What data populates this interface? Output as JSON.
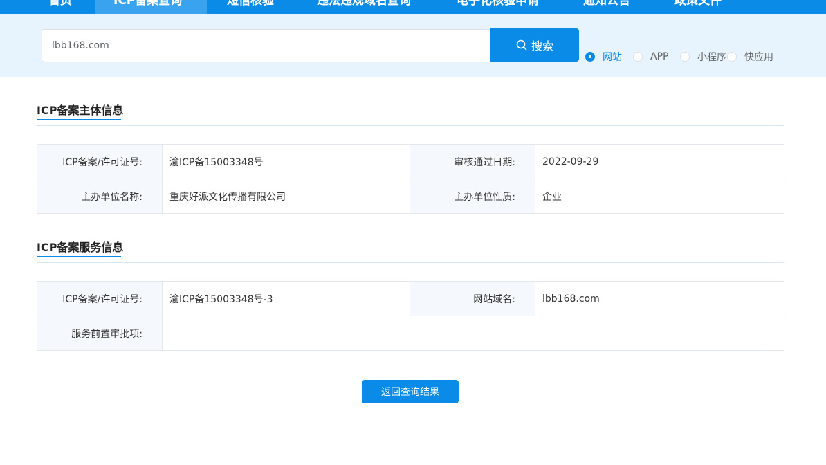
{
  "nav": {
    "items": [
      {
        "label": "首页"
      },
      {
        "label": "ICP备案查询"
      },
      {
        "label": "短信核验"
      },
      {
        "label": "违法违规域名查询"
      },
      {
        "label": "电子化核验申请"
      },
      {
        "label": "通知公告"
      },
      {
        "label": "政策文件"
      }
    ],
    "active_index": 1
  },
  "search": {
    "value": "lbb168.com",
    "button_label": "搜索",
    "options": [
      "网站",
      "APP",
      "小程序",
      "快应用"
    ],
    "selected": "网站"
  },
  "subject_section": {
    "title": "ICP备案主体信息",
    "rows": [
      [
        {
          "label": "ICP备案/许可证号:",
          "value": "渝ICP备15003348号"
        },
        {
          "label": "审核通过日期:",
          "value": "2022-09-29"
        }
      ],
      [
        {
          "label": "主办单位名称:",
          "value": "重庆好派文化传播有限公司"
        },
        {
          "label": "主办单位性质:",
          "value": "企业"
        }
      ]
    ]
  },
  "service_section": {
    "title": "ICP备案服务信息",
    "rows": [
      [
        {
          "label": "ICP备案/许可证号:",
          "value": "渝ICP备15003348号-3"
        },
        {
          "label": "网站域名:",
          "value": "lbb168.com"
        }
      ],
      [
        {
          "label": "服务前置审批项:",
          "value": ""
        }
      ]
    ]
  },
  "back_button_label": "返回查询结果",
  "colors": {
    "accent": "#0b8be8",
    "band": "#e8f4fd",
    "label_bg": "#f5f9fd"
  }
}
